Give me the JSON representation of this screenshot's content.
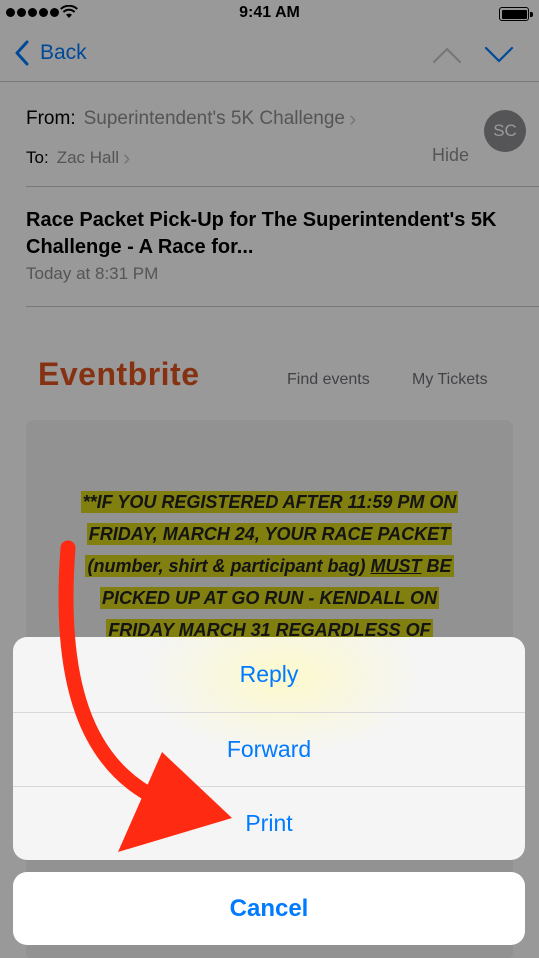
{
  "status_bar": {
    "time": "9:41 AM"
  },
  "nav": {
    "back_label": "Back"
  },
  "header": {
    "from_label": "From:",
    "from_value": "Superintendent's 5K Challenge",
    "to_label": "To:",
    "to_value": "Zac Hall",
    "hide_label": "Hide",
    "avatar_initials": "SC"
  },
  "email": {
    "subject": "Race Packet Pick-Up for The Superintendent's 5K Challenge - A Race for...",
    "date": "Today at 8:31 PM",
    "brand": "Eventbrite",
    "link_find_events": "Find events",
    "link_my_tickets": "My Tickets",
    "notice_line1": "**IF YOU REGISTERED AFTER 11:59 PM ON",
    "notice_line2": "FRIDAY, MARCH 24, YOUR RACE PACKET",
    "notice_line3a": "(number, shirt & participant bag) ",
    "notice_line3b": "MUST",
    "notice_line3c": " BE",
    "notice_line4": "PICKED UP AT GO RUN - KENDALL ON",
    "notice_line5": "FRIDAY MARCH 31 REGARDLESS OF"
  },
  "action_sheet": {
    "items": [
      {
        "label": "Reply"
      },
      {
        "label": "Forward"
      },
      {
        "label": "Print"
      }
    ],
    "cancel_label": "Cancel"
  },
  "colors": {
    "accent": "#007aff",
    "brand": "#e0541f",
    "highlight": "#d6d41c",
    "annotation_arrow": "#ff2a12"
  },
  "icons": [
    "signal-icon",
    "wifi-icon",
    "battery-icon",
    "back-chevron-icon",
    "chevron-up-icon",
    "chevron-down-icon",
    "disclosure-chevron-icon",
    "annotation-arrow"
  ]
}
